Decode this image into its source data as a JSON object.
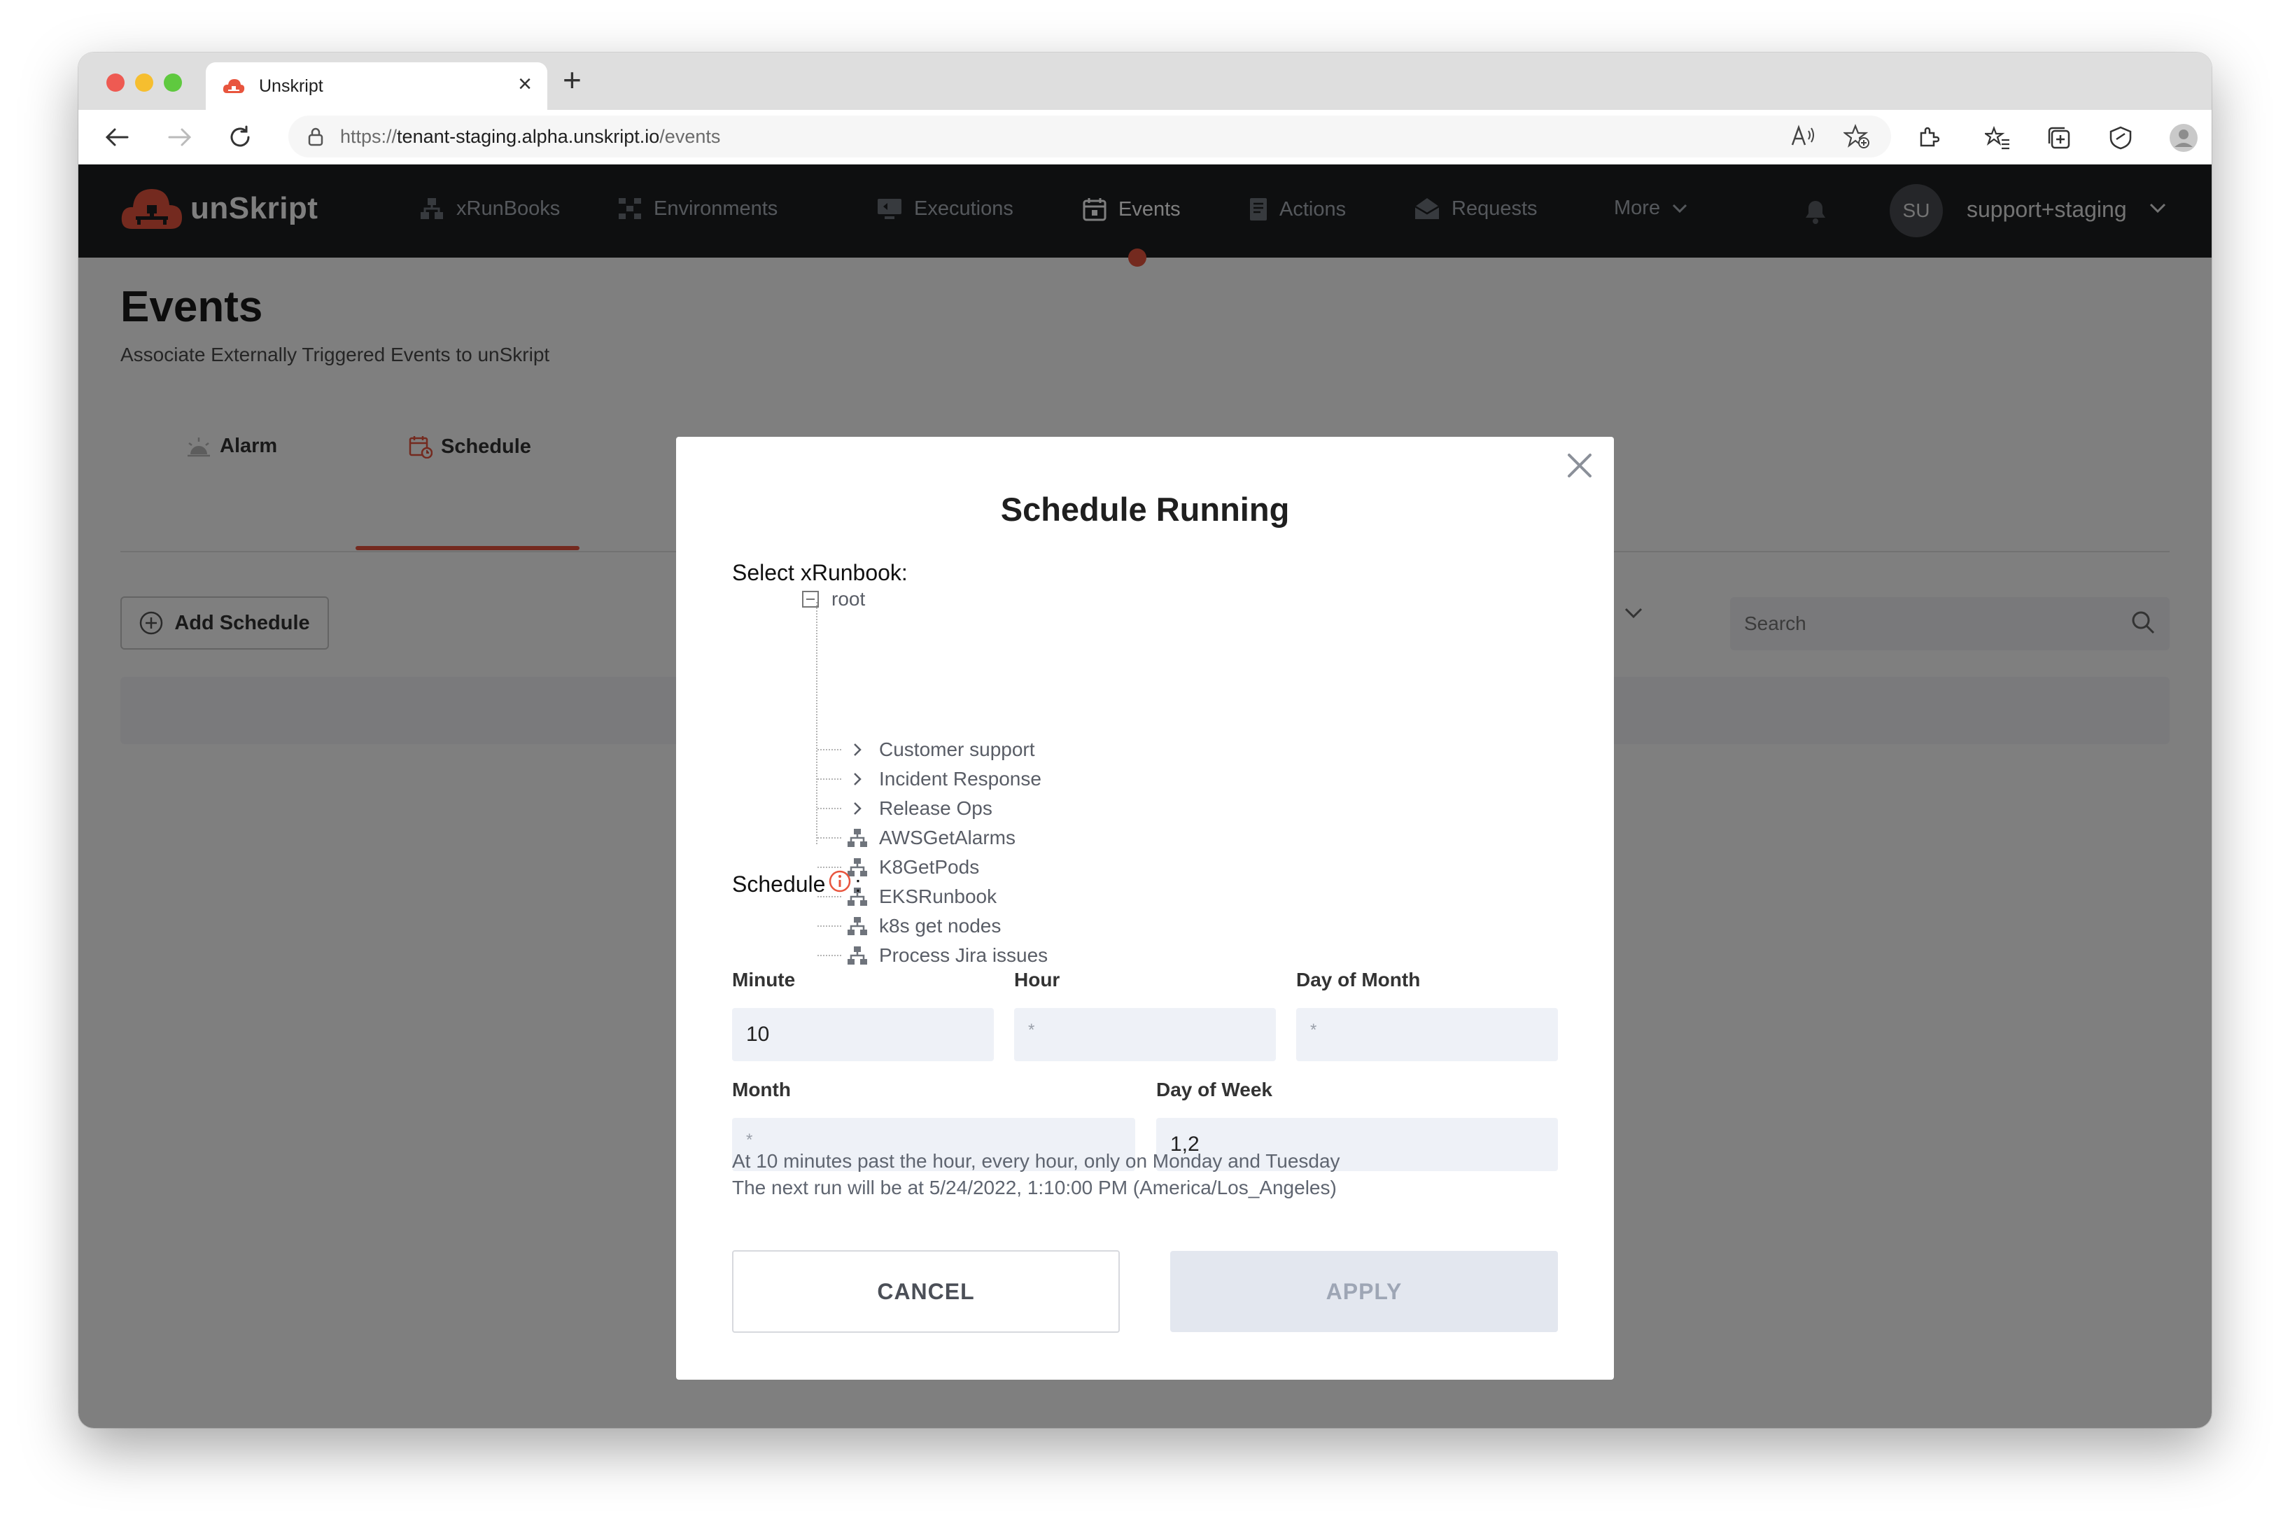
{
  "browser": {
    "tab_title": "Unskript",
    "url_prefix": "https://",
    "url_host": "tenant-staging.alpha.unskript.io",
    "url_path": "/events"
  },
  "app": {
    "brand": "unSkript",
    "nav": [
      {
        "label": "xRunBooks",
        "icon": "runbook-icon"
      },
      {
        "label": "Environments",
        "icon": "environments-icon"
      },
      {
        "label": "Executions",
        "icon": "executions-icon"
      },
      {
        "label": "Events",
        "icon": "calendar-icon",
        "active": true
      },
      {
        "label": "Actions",
        "icon": "actions-icon"
      },
      {
        "label": "Requests",
        "icon": "requests-icon"
      },
      {
        "label": "More",
        "icon": "chevron-down-icon"
      }
    ],
    "user_initials": "SU",
    "user_name": "support+staging",
    "accent_color": "#e8553e"
  },
  "page": {
    "title": "Events",
    "subtitle": "Associate Externally Triggered Events to unSkript",
    "tabs": [
      {
        "label": "Alarm"
      },
      {
        "label": "Schedule",
        "active": true
      }
    ],
    "add_button": "Add Schedule",
    "search_placeholder": "Search"
  },
  "modal": {
    "title": "Schedule Running",
    "select_label": "Select xRunbook:",
    "tree": {
      "root": "root",
      "folders": [
        "Customer support",
        "Incident Response",
        "Release Ops"
      ],
      "runbooks": [
        "AWSGetAlarms",
        "K8GetPods",
        "EKSRunbook",
        "k8s get nodes",
        "Process Jira issues"
      ]
    },
    "schedule_label": "Schedule",
    "schedule_colon": ":",
    "fields": {
      "minute": {
        "label": "Minute",
        "value": "10"
      },
      "hour": {
        "label": "Hour",
        "value": "*"
      },
      "day_of_month": {
        "label": "Day of Month",
        "value": "*"
      },
      "month": {
        "label": "Month",
        "value": "*"
      },
      "day_of_week": {
        "label": "Day of Week",
        "value": "1,2"
      }
    },
    "summary_line1": "At 10 minutes past the hour, every hour, only on Monday and Tuesday",
    "summary_line2": "The next run will be at 5/24/2022, 1:10:00 PM (America/Los_Angeles)",
    "cancel_label": "CANCEL",
    "apply_label": "APPLY"
  }
}
